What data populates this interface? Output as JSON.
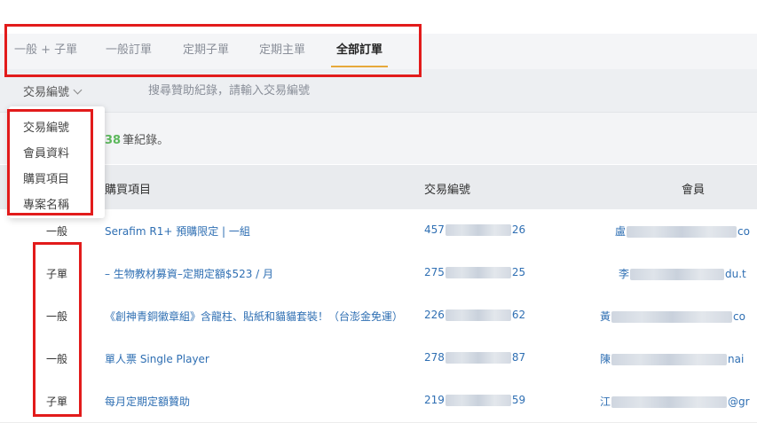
{
  "tabs": [
    {
      "label": "一般 + 子單"
    },
    {
      "label": "一般訂單"
    },
    {
      "label": "定期子單"
    },
    {
      "label": "定期主單"
    },
    {
      "label": "全部訂單"
    }
  ],
  "active_tab": "全部訂單",
  "search": {
    "field_selected": "交易編號",
    "placeholder": "搜尋贊助紀錄，請輸入交易編號"
  },
  "dropdown": {
    "options": [
      "交易編號",
      "會員資料",
      "購買項目",
      "專案名稱"
    ]
  },
  "records": {
    "count": "38",
    "suffix": "筆紀錄。"
  },
  "table": {
    "headers": {
      "item": "購買項目",
      "order": "交易編號",
      "member": "會員"
    },
    "rows": [
      {
        "type": "一般",
        "item": "Serafim R1+ 預購限定 | 一組",
        "order_start": "457",
        "order_end": "26",
        "member_start": "盧",
        "member_end": "co"
      },
      {
        "type": "子單",
        "item": "– 生物教材募資–定期定額$523 / 月",
        "order_start": "275",
        "order_end": "25",
        "member_start": "李",
        "member_end": "du.t"
      },
      {
        "type": "一般",
        "item": "《創神青銅徽章組》含龍柱、貼紙和貓貓套裝！（台澎金免運）",
        "order_start": "226",
        "order_end": "62",
        "member_start": "黃",
        "member_end": "co"
      },
      {
        "type": "一般",
        "item": "單人票 Single Player",
        "order_start": "278",
        "order_end": "87",
        "member_start": "陳",
        "member_end": "nai"
      },
      {
        "type": "子單",
        "item": "每月定期定額贊助",
        "order_start": "219",
        "order_end": "59",
        "member_start": "江",
        "member_end": "@gr"
      }
    ]
  }
}
